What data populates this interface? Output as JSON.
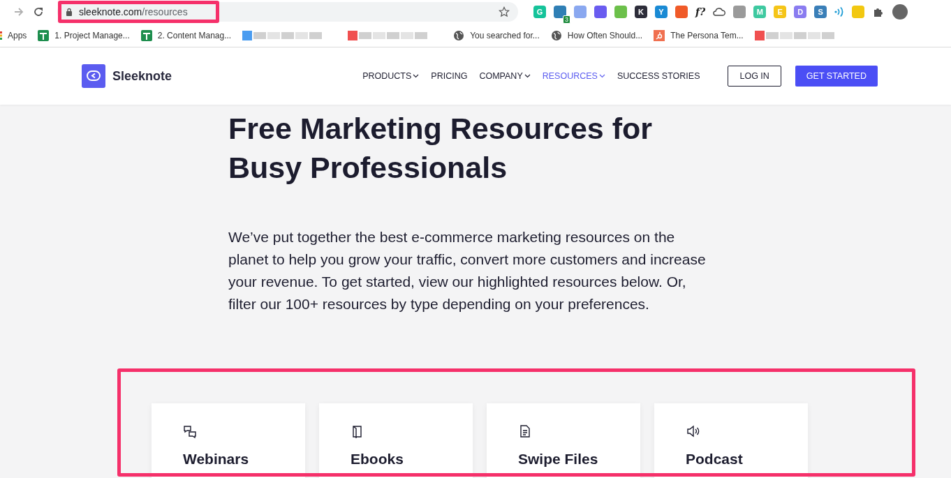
{
  "browser": {
    "url_host": "sleeknote.com",
    "url_path": "/resources",
    "extensions": [
      {
        "kind": "tile",
        "glyph": "G",
        "color": "#15c39a"
      },
      {
        "kind": "tile",
        "color": "#2f7fb5",
        "badge": "3"
      },
      {
        "kind": "tile",
        "color": "#8aa8f0"
      },
      {
        "kind": "tile",
        "color": "#6a5cf0"
      },
      {
        "kind": "tile",
        "color": "#6cc04a"
      },
      {
        "kind": "tile",
        "glyph": "K",
        "color": "#2d2d3a"
      },
      {
        "kind": "tile",
        "glyph": "Y",
        "color": "#1a8ad4"
      },
      {
        "kind": "tile",
        "color": "#f05a28"
      },
      {
        "kind": "text",
        "glyph": "f?"
      },
      {
        "kind": "cloud"
      },
      {
        "kind": "tile",
        "color": "#9a9a9a"
      },
      {
        "kind": "tile",
        "glyph": "M",
        "color": "#3ec9a0"
      },
      {
        "kind": "tile",
        "glyph": "E",
        "color": "#f5c518"
      },
      {
        "kind": "tile",
        "glyph": "D",
        "color": "#8a7cf0"
      },
      {
        "kind": "tile",
        "glyph": "S",
        "color": "#3a7fb8"
      },
      {
        "kind": "signal"
      },
      {
        "kind": "tile",
        "color": "#f2c811"
      }
    ]
  },
  "bookmarks": [
    {
      "kind": "apps",
      "label": "Apps"
    },
    {
      "kind": "sheet",
      "label": "1. Project Manage..."
    },
    {
      "kind": "sheet",
      "label": "2. Content Manag..."
    },
    {
      "kind": "blurred",
      "color": "#4a9cf0"
    },
    {
      "kind": "blurred",
      "color": "#f05050"
    },
    {
      "kind": "globe",
      "label": "You searched for..."
    },
    {
      "kind": "globe",
      "label": "How Often Should..."
    },
    {
      "kind": "hubspot",
      "label": "The Persona Tem..."
    },
    {
      "kind": "blurred",
      "color": "#f05050"
    }
  ],
  "site": {
    "brand": "Sleeknote",
    "nav": [
      {
        "label": "PRODUCTS",
        "dropdown": true,
        "selected": false
      },
      {
        "label": "PRICING",
        "dropdown": false,
        "selected": false
      },
      {
        "label": "COMPANY",
        "dropdown": true,
        "selected": false
      },
      {
        "label": "RESOURCES",
        "dropdown": true,
        "selected": true
      },
      {
        "label": "SUCCESS STORIES",
        "dropdown": false,
        "selected": false
      }
    ],
    "login": "LOG IN",
    "cta": "GET STARTED"
  },
  "hero": {
    "title": "Free Marketing Resources for Busy Professionals",
    "intro": "We’ve put together the best e-commerce marketing resources on the planet to help you grow your traffic, convert more customers and increase your revenue. To get started, view our highlighted resources below. Or, filter our 100+ resources by type depending on your preferences."
  },
  "cards": [
    {
      "kind": "chat",
      "title": "Webinars"
    },
    {
      "kind": "book",
      "title": "Ebooks"
    },
    {
      "kind": "file",
      "title": "Swipe Files"
    },
    {
      "kind": "speaker",
      "title": "Podcast"
    }
  ]
}
